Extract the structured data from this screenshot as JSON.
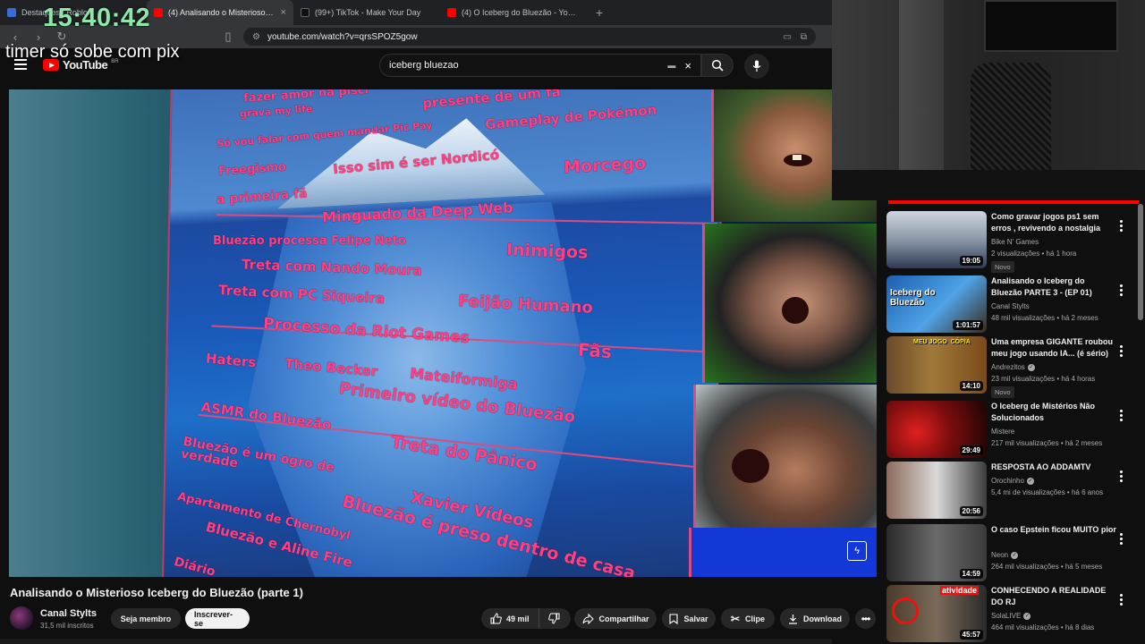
{
  "browser": {
    "tabs": [
      {
        "title": "Destaques | Roblox",
        "favicon_color": "#3b6bd6",
        "active": false
      },
      {
        "title": "(4) Analisando o Misterioso Iceberg",
        "favicon_color": "#ff0000",
        "active": true,
        "close": "×"
      },
      {
        "title": "(99+) TikTok - Make Your Day",
        "favicon_color": "#111111",
        "active": false
      },
      {
        "title": "(4) O Iceberg do Bluezão - YouTube",
        "favicon_color": "#ff0000",
        "active": false
      }
    ],
    "new_tab": "+",
    "url": "youtube.com/watch?v=qrsSPOZ5gow"
  },
  "overlay": {
    "timer": "15:40:42",
    "caption": "timer só sobe com pix"
  },
  "youtube": {
    "logo_text": "YouTube",
    "logo_region": "BR",
    "search_value": "iceberg bluezao",
    "search_clear": "×"
  },
  "player": {
    "labels": [
      "fazer amor na pisci",
      "grava my life",
      "presente de um fã",
      "Gameplay de Pokémon",
      "Só vou falar com quem mandar Pic Pay",
      "Isso sim é ser Nordicó",
      "Morcego",
      "Freegismo",
      "a primeira fã",
      "Minguado da Deep Web",
      "Bluezão processa Felipe Neto",
      "Inimigos",
      "Treta com Nando Moura",
      "Treta com PC Siqueira",
      "Feijão Humano",
      "Processo da Riot Games",
      "Fãs",
      "Haters",
      "Theo Becker",
      "Mateiformiga",
      "Primeiro vídeo do Bluezão",
      "ASMR do Bluezão",
      "Treta do Pânico",
      "Bluezão é um ogro de verdade",
      "Xavier Vídeos",
      "Apartamento de Chernobyl",
      "Bluezão é preso dentro de casa",
      "Bluezão e Aline Fire",
      "Diário"
    ]
  },
  "video": {
    "title": "Analisando o Misterioso Iceberg do Bluezão (parte 1)",
    "channel": "Canal Stylts",
    "subscribers": "31,5 mil inscritos",
    "join_label": "Seja membro",
    "subscribe_label": "Inscrever-se",
    "likes": "49 mil",
    "share_label": "Compartilhar",
    "save_label": "Salvar",
    "clip_label": "Clipe",
    "download_label": "Download",
    "more": "•••"
  },
  "recommendations": [
    {
      "title": "Como gravar jogos ps1 sem erros , revivendo a nostalgia",
      "channel": "Bike N' Games",
      "verified": false,
      "meta": "2 visualizações • há 1 hora",
      "duration": "19:05",
      "badge": "Novo",
      "thumb_color": "#3a4a6a"
    },
    {
      "title": "Analisando o Iceberg do Bluezão PARTE 3 - (EP 01)",
      "channel": "Canal Stylts",
      "verified": false,
      "meta": "48 mil visualizações • há 2 meses",
      "duration": "1:01:57",
      "badge": "",
      "thumb_color": "#2c78c7",
      "thumb_text": "Iceberg do Bluezão"
    },
    {
      "title": "Uma empresa GIGANTE roubou meu jogo usando IA... (é sério)",
      "channel": "Andrezitos",
      "verified": true,
      "meta": "23 mil visualizações • há 4 horas",
      "duration": "14:10",
      "badge": "Novo",
      "thumb_color": "#7a5a2a",
      "thumb_text": "MEU JOGO  CÓPIA"
    },
    {
      "title": "O Iceberg de Mistérios Não Solucionados",
      "channel": "Mistere",
      "verified": false,
      "meta": "217 mil visualizações • há 2 meses",
      "duration": "29:49",
      "badge": "",
      "thumb_color": "#7a0d0d"
    },
    {
      "title": "RESPOSTA AO ADDAMTV",
      "channel": "Orochinho",
      "verified": true,
      "meta": "5,4 mi de visualizações • há 6 anos",
      "duration": "20:56",
      "badge": "",
      "thumb_color": "#555555"
    },
    {
      "title": "O caso Epstein ficou MUITO pior",
      "channel": "Neon",
      "verified": true,
      "meta": "264 mil visualizações • há 5 meses",
      "duration": "14:59",
      "badge": "",
      "thumb_color": "#3c3c3c"
    },
    {
      "title": "CONHECENDO A REALIDADE DO RJ",
      "channel": "SolaLIVE",
      "verified": true,
      "meta": "464 mil visualizações • há 8 dias",
      "duration": "45:57",
      "badge": "",
      "thumb_color": "#5a4a3a",
      "thumb_text": "atividade"
    }
  ]
}
